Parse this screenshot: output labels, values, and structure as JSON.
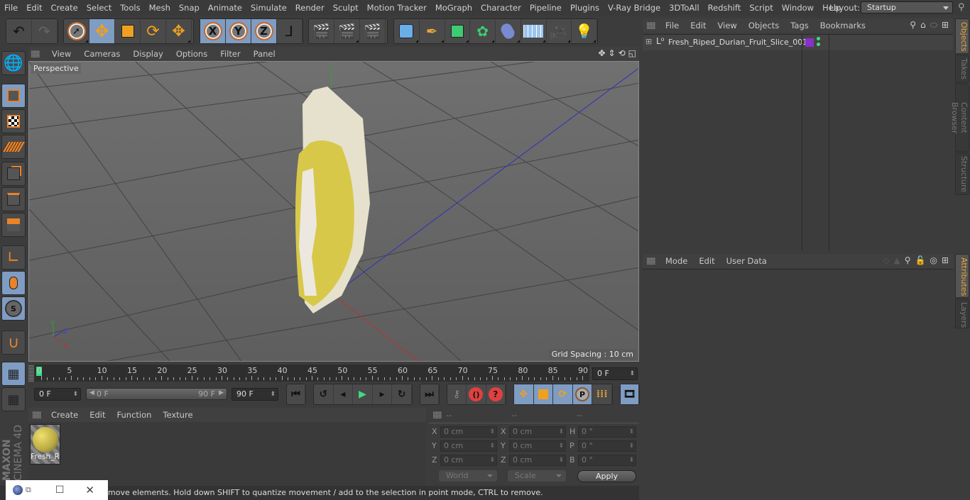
{
  "menubar": {
    "items": [
      "File",
      "Edit",
      "Create",
      "Select",
      "Tools",
      "Mesh",
      "Snap",
      "Animate",
      "Simulate",
      "Render",
      "Sculpt",
      "Motion Tracker",
      "MoGraph",
      "Character",
      "Pipeline",
      "Plugins",
      "V-Ray Bridge",
      "3DToAll",
      "Redshift",
      "Script",
      "Window",
      "Help"
    ],
    "layout_label": "Layout:",
    "layout_value": "Startup"
  },
  "toolbar": {
    "undo": "undo-icon",
    "redo": "redo-icon",
    "axis_x": "X",
    "axis_y": "Y",
    "axis_z": "Z"
  },
  "viewport": {
    "menu": [
      "View",
      "Cameras",
      "Display",
      "Options",
      "Filter",
      "Panel"
    ],
    "camera_label": "Perspective",
    "grid_spacing": "Grid Spacing : 10 cm",
    "axis_labels": {
      "x": "X",
      "y": "Y",
      "z": "Z"
    }
  },
  "timeline": {
    "ticks": [
      "0",
      "5",
      "10",
      "15",
      "20",
      "25",
      "30",
      "35",
      "40",
      "45",
      "50",
      "55",
      "60",
      "65",
      "70",
      "75",
      "80",
      "85",
      "90"
    ],
    "current_frame_field": "0 F",
    "start_field": "0 F",
    "range_start": "0 F",
    "range_end": "90 F",
    "end_field": "90 F"
  },
  "material_manager": {
    "menu": [
      "Create",
      "Edit",
      "Function",
      "Texture"
    ],
    "materials": [
      {
        "name": "Fresh_R"
      }
    ]
  },
  "coordinates": {
    "headers": [
      "--",
      "--",
      "--"
    ],
    "rows": [
      {
        "l1": "X",
        "v1": "0 cm",
        "l2": "X",
        "v2": "0 cm",
        "l3": "H",
        "v3": "0 °"
      },
      {
        "l1": "Y",
        "v1": "0 cm",
        "l2": "Y",
        "v2": "0 cm",
        "l3": "P",
        "v3": "0 °"
      },
      {
        "l1": "Z",
        "v1": "0 cm",
        "l2": "Z",
        "v2": "0 cm",
        "l3": "B",
        "v3": "0 °"
      }
    ],
    "mode_dropdown": "World",
    "transform_dropdown": "Scale",
    "apply_label": "Apply"
  },
  "status_bar": {
    "text": "move elements. Hold down SHIFT to quantize movement / add to the selection in point mode, CTRL to remove."
  },
  "object_manager": {
    "menu": [
      "File",
      "Edit",
      "View",
      "Objects",
      "Tags",
      "Bookmarks"
    ],
    "objects": [
      {
        "name": "Fresh_Riped_Durian_Fruit_Slice_001",
        "tag_color": "#8a2fc9"
      }
    ]
  },
  "attribute_manager": {
    "menu": [
      "Mode",
      "Edit",
      "User Data"
    ]
  },
  "side_tabs": {
    "top": [
      "Objects",
      "Takes",
      "Content Browser",
      "Structure"
    ],
    "bottom": [
      "Attributes",
      "Layers"
    ]
  },
  "branding": {
    "text1": "MAXON",
    "text2": "CINEMA 4D"
  },
  "colors": {
    "accent": "#7f9cc3",
    "active_tab": "#e8a53a",
    "playhead": "#3ddc84"
  }
}
